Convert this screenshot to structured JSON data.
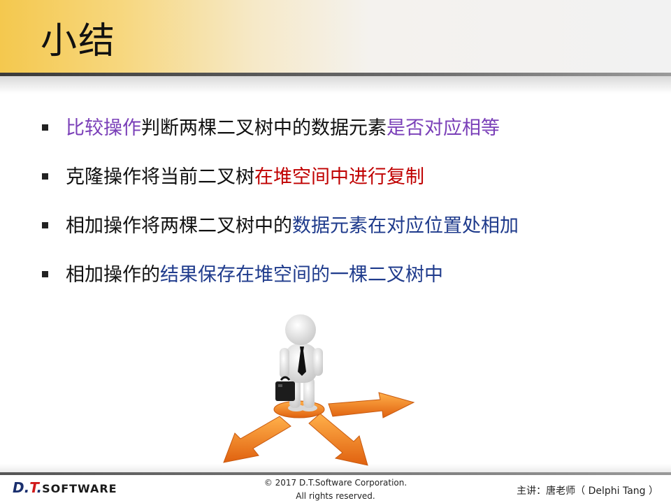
{
  "slide": {
    "title": "小结",
    "bullets": [
      {
        "segments": [
          {
            "text": "比较操作",
            "color": "purple"
          },
          {
            "text": "判断两棵二叉树中的数据元素",
            "color": "black"
          },
          {
            "text": "是否对应相等",
            "color": "purple"
          }
        ]
      },
      {
        "segments": [
          {
            "text": "克隆操作将当前二叉树",
            "color": "black"
          },
          {
            "text": "在堆空间中进行复制",
            "color": "red"
          }
        ]
      },
      {
        "segments": [
          {
            "text": "相加操作将两棵二叉树中的",
            "color": "black"
          },
          {
            "text": "数据元素在对应位置处相加",
            "color": "blue"
          }
        ]
      },
      {
        "segments": [
          {
            "text": "相加操作的",
            "color": "black"
          },
          {
            "text": "结果保存在堆空间的一棵二叉树中",
            "color": "blue"
          }
        ]
      }
    ]
  },
  "footer": {
    "logo_d": "D.",
    "logo_t": "T",
    "logo_dot": ".",
    "logo_software": "SOFTWARE",
    "copyright_line1": "© 2017 D.T.Software Corporation.",
    "copyright_line2": "All rights reserved.",
    "presenter": "主讲：唐老师（ Delphi Tang ）"
  },
  "colors": {
    "accent_gold": "#f4c84e",
    "purple": "#7a3fb8",
    "red": "#c00000",
    "blue": "#1f3b8c",
    "black": "#111111",
    "arrow_orange": "#f07a1a"
  },
  "illustration": {
    "icons": [
      "person-figure-icon",
      "briefcase-icon",
      "arrow-left-icon",
      "arrow-down-right-icon",
      "arrow-right-icon"
    ]
  }
}
